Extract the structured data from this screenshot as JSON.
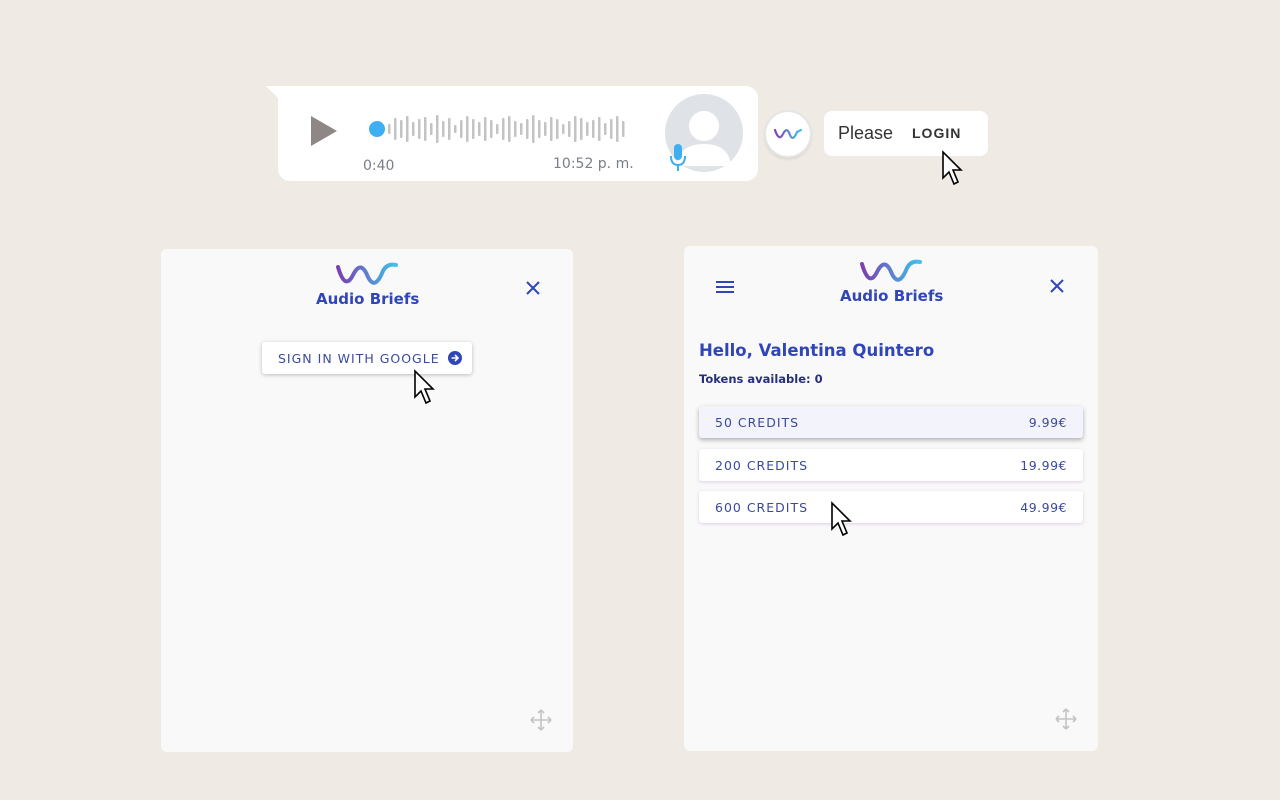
{
  "voice_message": {
    "duration": "0:40",
    "time": "10:52 p. m.",
    "icons": [
      "play-icon",
      "waveform",
      "avatar-icon",
      "microphone-icon"
    ]
  },
  "extension": {
    "icon": "audio-briefs-logo-icon",
    "popup": {
      "please": "Please",
      "login": "LOGIN"
    }
  },
  "login_panel": {
    "brand": "Audio Briefs",
    "google_button": "SIGN IN WITH GOOGLE",
    "icons": [
      "close-icon",
      "arrow-right-circle-icon",
      "move-icon"
    ]
  },
  "account_panel": {
    "brand": "Audio Briefs",
    "greeting": "Hello, Valentina Quintero",
    "tokens": "Tokens available: 0",
    "credits": [
      {
        "label": "50 CREDITS",
        "price": "9.99€"
      },
      {
        "label": "200 CREDITS",
        "price": "19.99€"
      },
      {
        "label": "600 CREDITS",
        "price": "49.99€"
      }
    ],
    "icons": [
      "menu-icon",
      "close-icon",
      "move-icon"
    ]
  },
  "colors": {
    "background": "#efebe4",
    "brand_blue": "#3046b8",
    "text_blue": "#3a4a9c",
    "wave_purple": "#8a3db5",
    "wave_cyan": "#3fc3ea",
    "progress_dot": "#3daff2"
  }
}
